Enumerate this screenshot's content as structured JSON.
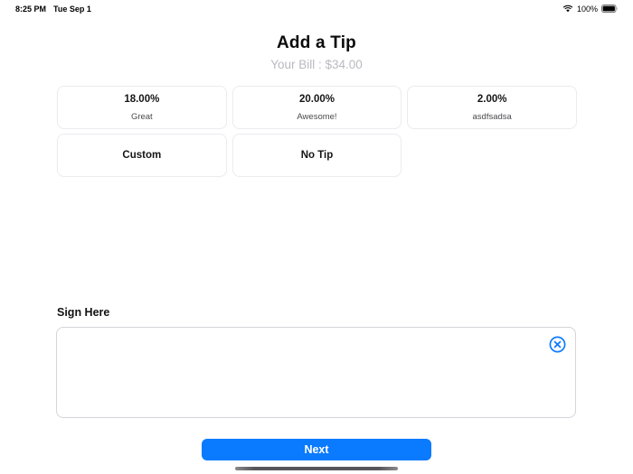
{
  "status_bar": {
    "time": "8:25 PM",
    "date": "Tue Sep 1",
    "battery_percent": "100%"
  },
  "header": {
    "title": "Add a Tip",
    "bill_label": "Your Bill : $34.00"
  },
  "tips": {
    "buttons": [
      {
        "percent": "18.00%",
        "label": "Great"
      },
      {
        "percent": "20.00%",
        "label": "Awesome!"
      },
      {
        "percent": "2.00%",
        "label": "asdfsadsa"
      },
      {
        "label": "Custom"
      },
      {
        "label": "No Tip"
      }
    ]
  },
  "signature": {
    "label": "Sign Here",
    "clear_icon": "x-circle-icon"
  },
  "footer": {
    "next_label": "Next"
  },
  "colors": {
    "accent_blue": "#0a7aff",
    "subtitle_gray": "#b9b9c0",
    "card_border": "#ececf0",
    "signature_border": "#d4d4da"
  }
}
